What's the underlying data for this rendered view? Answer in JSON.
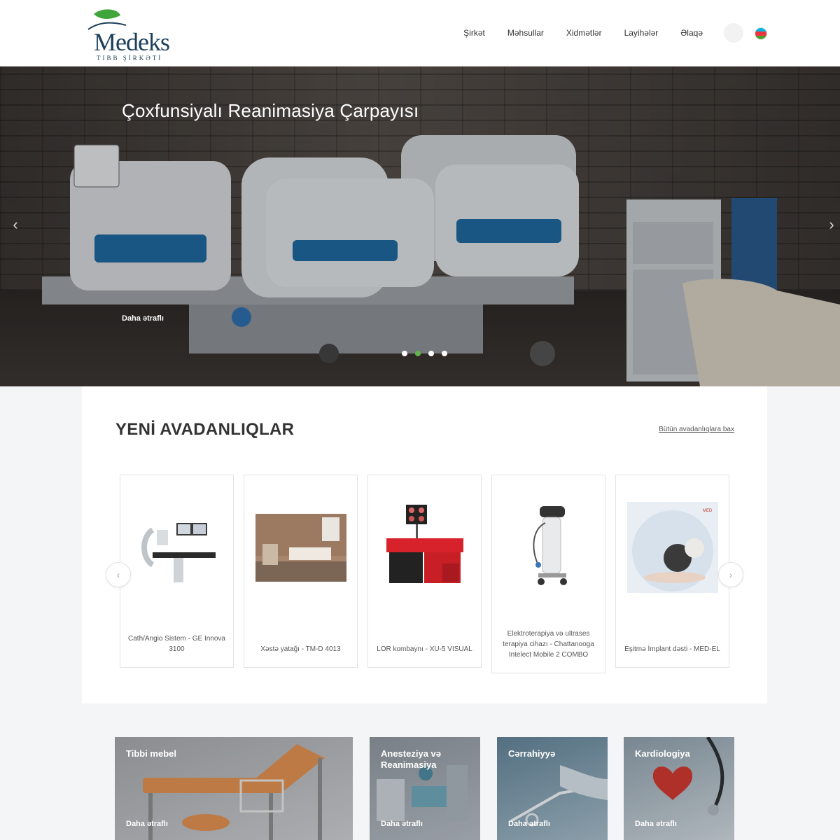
{
  "header": {
    "logo_name": "Medeks",
    "logo_sub": "TIBB ŞİRKƏTİ",
    "nav": [
      {
        "label": "Şirkət"
      },
      {
        "label": "Məhsullar"
      },
      {
        "label": "Xidmətlər"
      },
      {
        "label": "Layihələr"
      },
      {
        "label": "Əlaqə"
      }
    ],
    "flag_colors": [
      "#00b5e2",
      "#ef3340",
      "#509e2f"
    ]
  },
  "hero": {
    "title": "Çoxfunsiyalı Reanimasiya Çarpayısı",
    "more_label": "Daha ətraflı",
    "slides": 4,
    "active_slide": 2
  },
  "new_equipment": {
    "title": "YENİ AVADANLIQLAR",
    "see_all": "Bütün avadanlıqlara bax",
    "products": [
      {
        "title": "Cath/Angio Sistem - GE Innova 3100"
      },
      {
        "title": "Xəstə yatağı - TM-D 4013"
      },
      {
        "title": "LOR kombaynı - XU-5 VISUAL"
      },
      {
        "title": "Elektroterapiya və ultrases terapiya cihazı - Chattanooga Intelect Mobile 2 COMBO"
      },
      {
        "title": "Eşitmə İmplant dəsti - MED-EL"
      }
    ]
  },
  "categories": [
    {
      "title": "Tibbi mebel",
      "more": "Daha ətraflı"
    },
    {
      "title": "Anesteziya və Reanimasiya",
      "more": "Daha ətraflı"
    },
    {
      "title": "Cərrahiyyə",
      "more": "Daha ətraflı"
    },
    {
      "title": "Kardiologiya",
      "more": "Daha ətraflı"
    }
  ],
  "colors": {
    "accent_green": "#62b34a",
    "brand_navy": "#1c3f5a"
  }
}
